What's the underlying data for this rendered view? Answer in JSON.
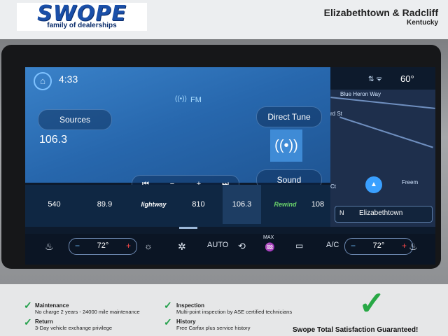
{
  "header": {
    "brand": "SWOPE",
    "tagline": "family of dealerships",
    "location_city": "Elizabethtown & Radcliff",
    "location_state": "Kentucky"
  },
  "screen": {
    "time": "4:33",
    "outside_temp": "60°",
    "band": "FM",
    "sources_label": "Sources",
    "frequency": "106.3",
    "direct_tune_label": "Direct Tune",
    "sound_label": "Sound",
    "controls": [
      "⏮",
      "−",
      "+",
      "⏭"
    ],
    "presets": [
      {
        "label": "540"
      },
      {
        "label": "89.9"
      },
      {
        "label": "lightway"
      },
      {
        "label": "810"
      },
      {
        "label": "106.3"
      },
      {
        "label": "Rewind"
      },
      {
        "label": "108"
      }
    ],
    "map": {
      "street1": "Blue Heron Way",
      "street2": "rd St",
      "street3": "Ct",
      "street4": "Freem",
      "nav_direction": "N",
      "nav_city": "Elizabethtown"
    },
    "climate": {
      "driver_temp": "72°",
      "passenger_temp": "72°",
      "auto_label": "AUTO",
      "max_label": "MAX",
      "ac_label": "A/C"
    }
  },
  "footer": {
    "features": [
      {
        "title": "Maintenance",
        "desc": "No charge 2 years - 24000 mile maintenance"
      },
      {
        "title": "Return",
        "desc": "3-Day vehicle exchange privilege"
      },
      {
        "title": "Inspection",
        "desc": "Multi-point inspection by ASE certified technicians"
      },
      {
        "title": "History",
        "desc": "Free Carfax plus service history"
      }
    ],
    "guarantee": "Swope Total Satisfaction Guaranteed!"
  }
}
